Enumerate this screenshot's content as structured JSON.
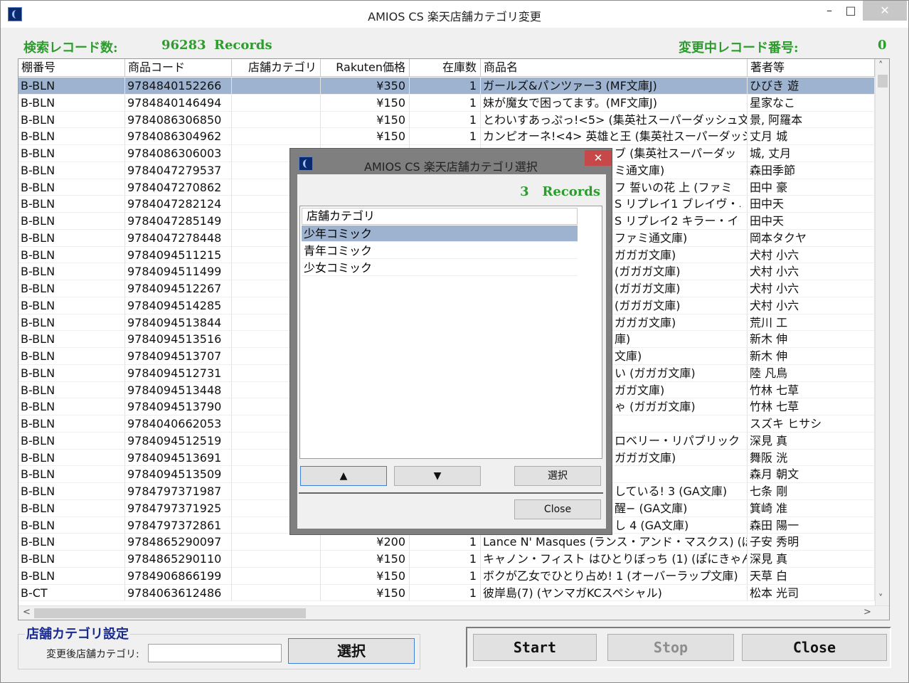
{
  "window": {
    "title": "AMIOS CS 楽天店舗カテゴリ変更"
  },
  "status": {
    "search_label": "検索レコード数:",
    "count": "96283",
    "records_unit": "Records",
    "current_label": "変更中レコード番号:",
    "current_value": "0"
  },
  "grid": {
    "columns": [
      "棚番号",
      "商品コード",
      "店舗カテゴリ",
      "Rakuten価格",
      "在庫数",
      "商品名",
      "著者等"
    ],
    "rows": [
      [
        "B-BLN",
        "9784840152266",
        "",
        "¥350",
        "1",
        "ガールズ&パンツァー3 (MF文庫J)",
        "ひびき 遊"
      ],
      [
        "B-BLN",
        "9784840146494",
        "",
        "¥150",
        "1",
        "妹が魔女で困ってます。(MF文庫J)",
        "星家なこ"
      ],
      [
        "B-BLN",
        "9784086306850",
        "",
        "¥150",
        "1",
        "とわいすあっぷっ!<5> (集英社スーパーダッシュ文",
        "景, 阿羅本"
      ],
      [
        "B-BLN",
        "9784086304962",
        "",
        "¥150",
        "1",
        "カンピオーネ!<4> 英雄と王 (集英社スーパーダッシ",
        "丈月 城"
      ],
      [
        "B-BLN",
        "9784086306003",
        "",
        "",
        "",
        "",
        "城, 丈月"
      ],
      [
        "B-BLN",
        "9784047279537",
        "",
        "",
        "",
        "",
        "森田季節"
      ],
      [
        "B-BLN",
        "9784047270862",
        "",
        "",
        "",
        "",
        "田中 豪"
      ],
      [
        "B-BLN",
        "9784047282124",
        "",
        "",
        "",
        "",
        "田中天"
      ],
      [
        "B-BLN",
        "9784047285149",
        "",
        "",
        "",
        "",
        "田中天"
      ],
      [
        "B-BLN",
        "9784047278448",
        "",
        "",
        "",
        "",
        "岡本タクヤ"
      ],
      [
        "B-BLN",
        "9784094511215",
        "",
        "",
        "",
        "",
        "犬村 小六"
      ],
      [
        "B-BLN",
        "9784094511499",
        "",
        "",
        "",
        "",
        "犬村 小六"
      ],
      [
        "B-BLN",
        "9784094512267",
        "",
        "",
        "",
        "",
        "犬村 小六"
      ],
      [
        "B-BLN",
        "9784094514285",
        "",
        "",
        "",
        "",
        "犬村 小六"
      ],
      [
        "B-BLN",
        "9784094513844",
        "",
        "",
        "",
        "",
        "荒川 工"
      ],
      [
        "B-BLN",
        "9784094513516",
        "",
        "",
        "",
        "",
        "新木 伸"
      ],
      [
        "B-BLN",
        "9784094513707",
        "",
        "",
        "",
        "",
        "新木 伸"
      ],
      [
        "B-BLN",
        "9784094512731",
        "",
        "",
        "",
        "",
        "陸 凡鳥"
      ],
      [
        "B-BLN",
        "9784094513448",
        "",
        "",
        "",
        "",
        "竹林 七草"
      ],
      [
        "B-BLN",
        "9784094513790",
        "",
        "",
        "",
        "",
        "竹林 七草"
      ],
      [
        "B-BLN",
        "9784040662053",
        "",
        "",
        "",
        "",
        "スズキ ヒサシ"
      ],
      [
        "B-BLN",
        "9784094512519",
        "",
        "",
        "",
        "",
        "深見 真"
      ],
      [
        "B-BLN",
        "9784094513691",
        "",
        "",
        "",
        "",
        "舞阪 洸"
      ],
      [
        "B-BLN",
        "9784094513509",
        "",
        "",
        "",
        "",
        "森月 朝文"
      ],
      [
        "B-BLN",
        "9784797371987",
        "",
        "",
        "",
        "",
        "七条 剛"
      ],
      [
        "B-BLN",
        "9784797371925",
        "",
        "",
        "",
        "",
        "箕崎 准"
      ],
      [
        "B-BLN",
        "9784797372861",
        "",
        "",
        "",
        "",
        "森田 陽一"
      ],
      [
        "B-BLN",
        "9784865290097",
        "",
        "¥200",
        "1",
        "Lance N' Masques (ランス・アンド・マスクス) (ぽ",
        "子安 秀明"
      ],
      [
        "B-BLN",
        "9784865290110",
        "",
        "¥150",
        "1",
        "キャノン・フィスト はひとりぼっち (1) (ぽにきゃんBO",
        "深見 真"
      ],
      [
        "B-BLN",
        "9784906866199",
        "",
        "¥150",
        "1",
        "ボクが乙女でひとり占め! 1 (オーバーラップ文庫)",
        "天草 白"
      ],
      [
        "B-CT",
        "9784063612486",
        "",
        "¥150",
        "1",
        "彼岸島(7) (ヤンマガKCスペシャル)",
        "松本 光司"
      ]
    ],
    "partial_titles": {
      "r4": "ブ (集英社スーパーダッ",
      "r5": "ミ通文庫)",
      "r6": "フ 誓いの花 上 (ファミ",
      "r7": "S リプレイ1 ブレイヴ・ニ",
      "r8": "S リプレイ2 キラー・イン・",
      "r9": "ファミ通文庫)",
      "r10": "ガガガ文庫)",
      "r11": "(ガガガ文庫)",
      "r12": "(ガガガ文庫)",
      "r13": "(ガガガ文庫)",
      "r14": "ガガガ文庫)",
      "r15": "庫)",
      "r16": "文庫)",
      "r17": "い (ガガガ文庫)",
      "r18": "ガガ文庫)",
      "r19": "ゃ (ガガガ文庫)",
      "r21": "ロベリー・リパブリック 2",
      "r22": "ガガガ文庫)",
      "r24": "している! 3 (GA文庫)",
      "r25": "醒− (GA文庫)",
      "r26": "し 4 (GA文庫)"
    }
  },
  "settings": {
    "group_title": "店舗カテゴリ設定",
    "after_label": "変更後店舗カテゴリ:",
    "after_value": "",
    "select_button": "選択"
  },
  "buttons": {
    "start": "Start",
    "stop": "Stop",
    "close": "Close"
  },
  "dialog": {
    "title": "AMIOS CS 楽天店舗カテゴリ選択",
    "count": "3",
    "records_unit": "Records",
    "list_header": "店舗カテゴリ",
    "items": [
      "少年コミック",
      "青年コミック",
      "少女コミック"
    ],
    "selected_index": 0,
    "up_label": "▲",
    "down_label": "▼",
    "select_label": "選択",
    "close_label": "Close"
  }
}
